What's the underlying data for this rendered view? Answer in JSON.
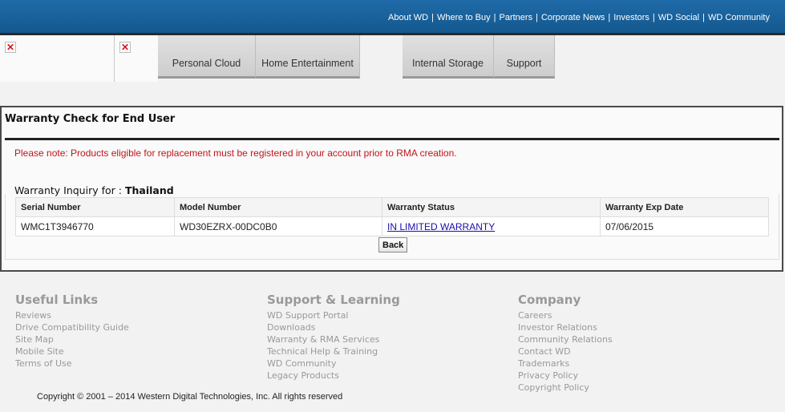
{
  "header": {
    "links": [
      "About WD",
      "Where to Buy",
      "Partners",
      "Corporate News",
      "Investors",
      "WD Social",
      "WD Community"
    ]
  },
  "nav": {
    "tabs": [
      "Personal Cloud",
      "Home Entertainment",
      "",
      "Internal Storage",
      "Support"
    ]
  },
  "panel": {
    "title": "Warranty Check for End User",
    "notice": "Please note: Products eligible for replacement must be registered in your account prior to RMA creation.",
    "inquiry_label": "Warranty Inquiry for :",
    "inquiry_country": "Thailand",
    "table": {
      "headers": [
        "Serial Number",
        "Model Number",
        "Warranty Status",
        "Warranty Exp Date"
      ],
      "row": {
        "serial": "WMC1T3946770",
        "model": "WD30EZRX-00DC0B0",
        "status": "IN LIMITED WARRANTY",
        "exp_date": "07/06/2015"
      }
    },
    "back_label": "Back"
  },
  "footer": {
    "useful_links": {
      "title": "Useful Links",
      "items": [
        "Reviews",
        "Drive Compatibility Guide",
        "Site Map",
        "Mobile Site",
        "Terms of Use"
      ]
    },
    "support": {
      "title": "Support & Learning",
      "items": [
        "WD Support Portal",
        "Downloads",
        "Warranty & RMA Services",
        "Technical Help & Training",
        "WD Community",
        "Legacy Products"
      ]
    },
    "company": {
      "title": "Company",
      "items": [
        "Careers",
        "Investor Relations",
        "Community Relations",
        "Contact WD",
        "Trademarks",
        "Privacy Policy",
        "Copyright Policy"
      ]
    },
    "copyright": "Copyright © 2001 – 2014 Western Digital Technologies, Inc. All rights reserved"
  },
  "colors": {
    "header_blue": "#1a64a0",
    "notice_red": "#c0141b",
    "link_blue": "#1a0dab"
  }
}
